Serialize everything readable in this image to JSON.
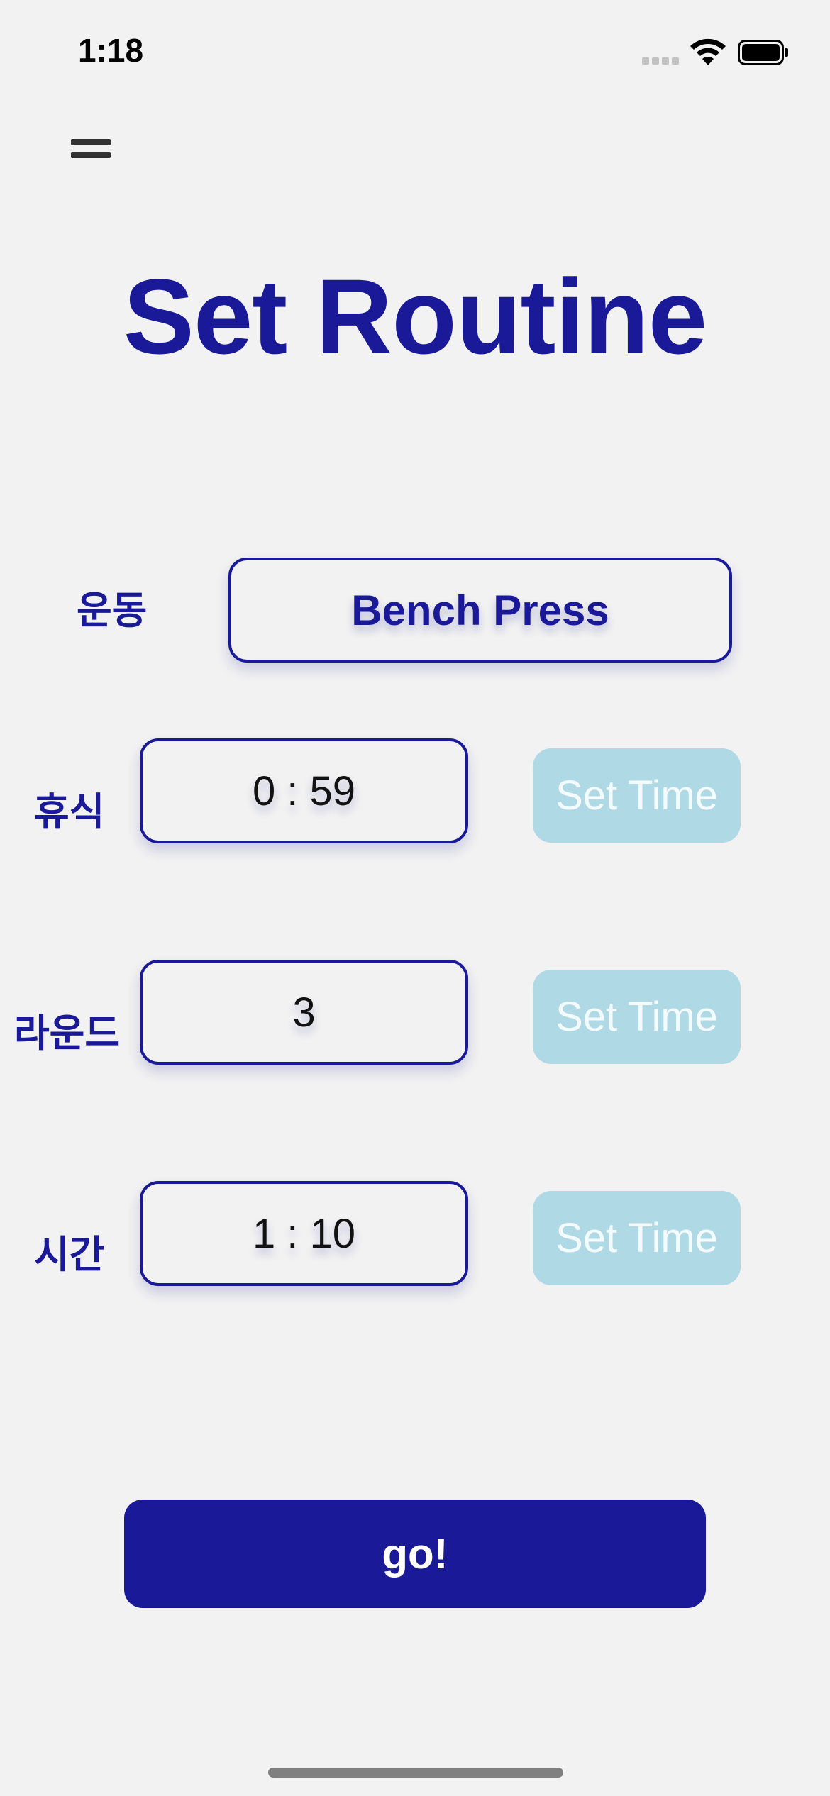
{
  "status_bar": {
    "time": "1:18"
  },
  "title": "Set Routine",
  "rows": {
    "exercise": {
      "label": "운동",
      "value": "Bench Press"
    },
    "rest": {
      "label": "휴식",
      "value": "0 : 59",
      "button": "Set Time"
    },
    "rounds": {
      "label": "라운드",
      "value": "3",
      "button": "Set Time"
    },
    "time": {
      "label": "시간",
      "value": "1 : 10",
      "button": "Set Time"
    }
  },
  "go_button": "go!",
  "colors": {
    "primary": "#1a1a99",
    "secondary_button": "#b0d9e6",
    "background": "#f2f2f2"
  }
}
